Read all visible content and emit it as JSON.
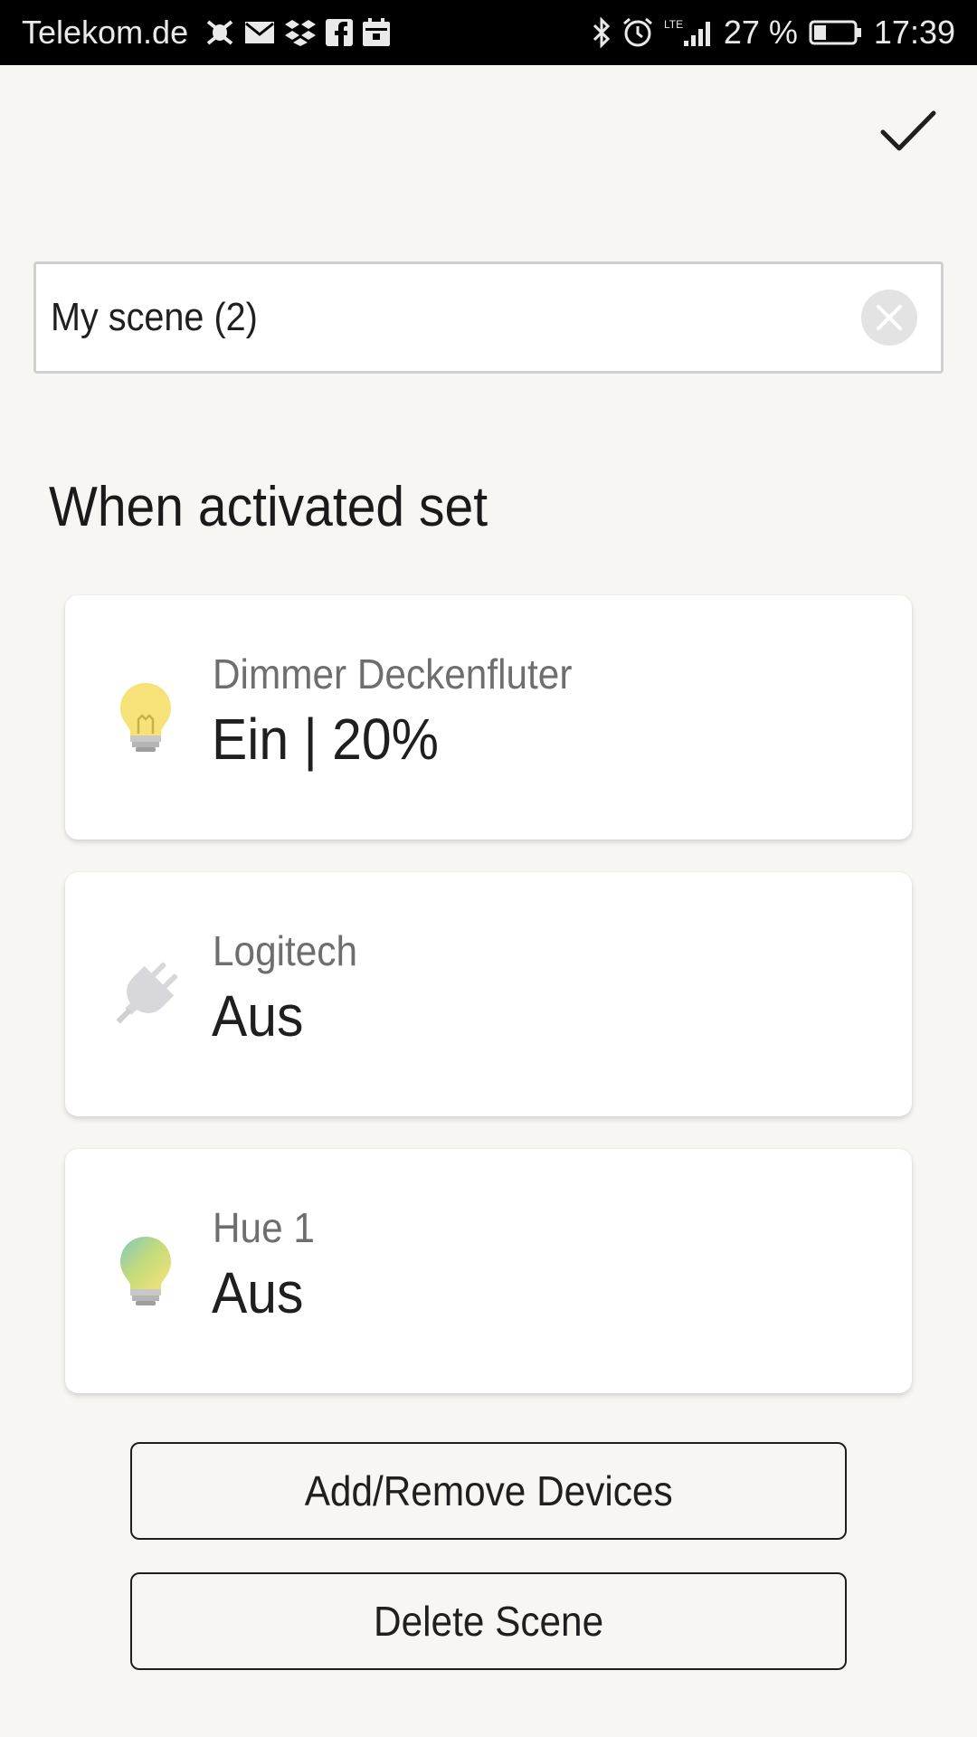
{
  "status_bar": {
    "carrier": "Telekom.de",
    "network": "LTE",
    "battery_text": "27 %",
    "time": "17:39",
    "left_icons": [
      "bug-icon",
      "mail-icon",
      "dropbox-icon",
      "facebook-icon",
      "calendar-icon"
    ],
    "right_icons": [
      "bluetooth-icon",
      "alarm-icon",
      "signal-icon",
      "battery-icon"
    ]
  },
  "header": {
    "confirm_icon": "check-icon"
  },
  "scene_name": {
    "value": "My scene (2)",
    "clear_icon": "clear-icon"
  },
  "section_title": "When activated set",
  "devices": [
    {
      "name": "Dimmer Deckenfluter",
      "state": "Ein | 20%",
      "icon": "bulb-yellow-icon",
      "color": "#f7e27a"
    },
    {
      "name": "Logitech",
      "state": "Aus",
      "icon": "plug-icon",
      "color": "#d8d8dc"
    },
    {
      "name": "Hue 1",
      "state": "Aus",
      "icon": "bulb-hue-icon",
      "color": "#b8d88a"
    }
  ],
  "buttons": {
    "add_remove": "Add/Remove Devices",
    "delete": "Delete Scene"
  },
  "colors": {
    "background": "#f8f6f2",
    "card": "#ffffff",
    "text": "#1f1f1f",
    "secondary_text": "#6e6e6e"
  }
}
